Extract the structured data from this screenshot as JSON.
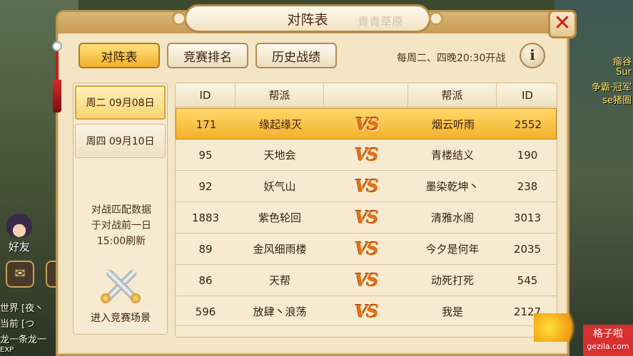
{
  "dialog": {
    "title": "对阵表",
    "title_decoration": "青青草原",
    "close_label": "✕"
  },
  "tabs": [
    {
      "label": "对阵表",
      "active": true
    },
    {
      "label": "竞赛排名",
      "active": false
    },
    {
      "label": "历史战绩",
      "active": false
    }
  ],
  "schedule_text": "每周二、四晚20:30开战",
  "info_label": "i",
  "dates": [
    {
      "label": "周二  09月08日",
      "active": true
    },
    {
      "label": "周四  09月10日",
      "active": false
    }
  ],
  "note_lines": [
    "对战匹配数据",
    "于对战前一日",
    "15:00刷新"
  ],
  "enter_arena_label": "进入竞赛场景",
  "table": {
    "headers": [
      "ID",
      "帮派",
      "",
      "帮派",
      "ID"
    ],
    "vs_label": "VS",
    "rows": [
      {
        "left_id": "171",
        "left_guild": "缘起缘灭",
        "right_guild": "烟云听雨",
        "right_id": "2552"
      },
      {
        "left_id": "95",
        "left_guild": "天地会",
        "right_guild": "青楼结义",
        "right_id": "190"
      },
      {
        "left_id": "92",
        "left_guild": "妖气山",
        "right_guild": "墨染乾坤丶",
        "right_id": "238"
      },
      {
        "left_id": "1883",
        "left_guild": "紫色轮回",
        "right_guild": "清雅水阁",
        "right_id": "3013"
      },
      {
        "left_id": "89",
        "left_guild": "金风细雨楼",
        "right_guild": "今夕是何年",
        "right_id": "2035"
      },
      {
        "left_id": "86",
        "left_guild": "天帮",
        "right_guild": "动死打死",
        "right_id": "545"
      },
      {
        "left_id": "596",
        "left_guild": "放肆丶浪荡",
        "right_guild": "我是",
        "right_id": "2127"
      }
    ]
  },
  "sidebar": {
    "friend_label": "好友",
    "chat_lines": [
      "世界 [夜丶",
      "当前 [つ",
      "龙一条龙一"
    ],
    "exp_label": "EXP"
  },
  "right_scene_texts": [
    "瘤谷",
    "Sur",
    "争霸·冠军",
    "se猪圈"
  ],
  "watermark": {
    "title": "格子啦",
    "sub": "gezila.com"
  }
}
